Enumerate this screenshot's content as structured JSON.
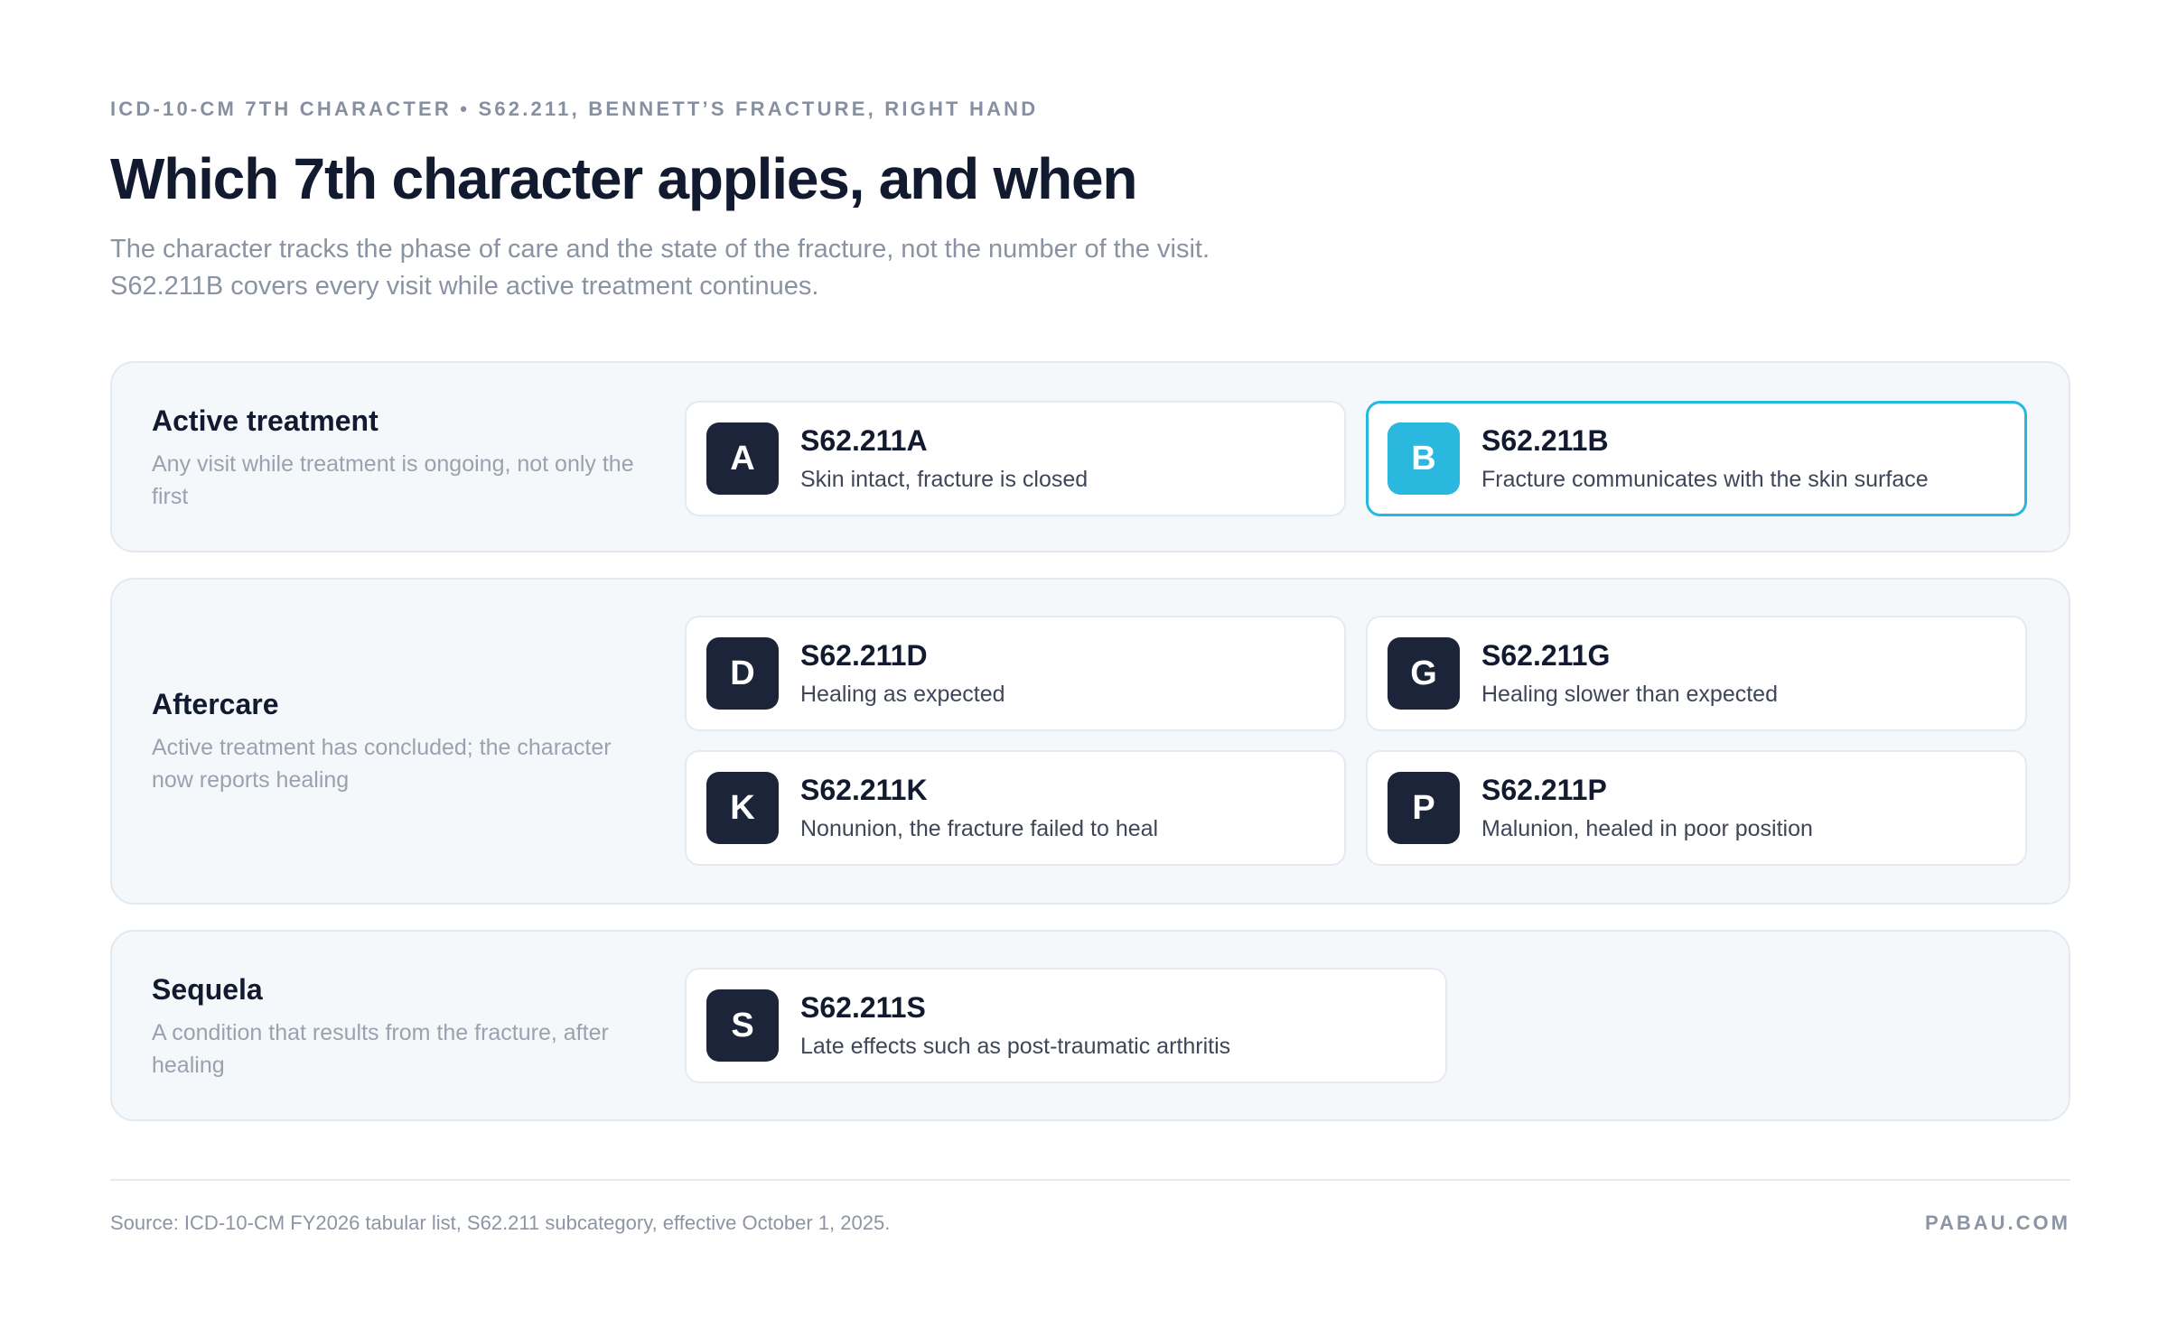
{
  "header": {
    "eyebrow": "ICD-10-CM 7TH CHARACTER • S62.211, BENNETT’S FRACTURE, RIGHT HAND",
    "title": "Which 7th character applies, and when",
    "subtitle_line1": "The character tracks the phase of care and the state of the fracture, not the number of the visit.",
    "subtitle_line2": "S62.211B covers every visit while active treatment continues."
  },
  "groups": [
    {
      "title": "Active treatment",
      "description": "Any visit while treatment is ongoing, not only the first",
      "cards": [
        {
          "letter": "A",
          "code": "S62.211A",
          "description": "Skin intact, fracture is closed",
          "selected": false
        },
        {
          "letter": "B",
          "code": "S62.211B",
          "description": "Fracture communicates with the skin surface",
          "selected": true
        }
      ]
    },
    {
      "title": "Aftercare",
      "description": "Active treatment has concluded; the character now reports healing",
      "cards": [
        {
          "letter": "D",
          "code": "S62.211D",
          "description": "Healing as expected",
          "selected": false
        },
        {
          "letter": "G",
          "code": "S62.211G",
          "description": "Healing slower than expected",
          "selected": false
        },
        {
          "letter": "K",
          "code": "S62.211K",
          "description": "Nonunion, the fracture failed to heal",
          "selected": false
        },
        {
          "letter": "P",
          "code": "S62.211P",
          "description": "Malunion, healed in poor position",
          "selected": false
        }
      ]
    },
    {
      "title": "Sequela",
      "description": "A condition that results from the fracture, after healing",
      "cards": [
        {
          "letter": "S",
          "code": "S62.211S",
          "description": "Late effects such as post-traumatic arthritis",
          "selected": false
        }
      ]
    }
  ],
  "footer": {
    "source": "Source: ICD-10-CM FY2026 tabular list, S62.211 subcategory, effective October 1, 2025.",
    "brand": "PABAU.COM"
  },
  "colors": {
    "accent": "#2bb8de",
    "badge_dark": "#1c2439",
    "panel_bg": "#f5f8fb",
    "text_dark": "#111a2e",
    "text_muted": "#8a93a3"
  }
}
